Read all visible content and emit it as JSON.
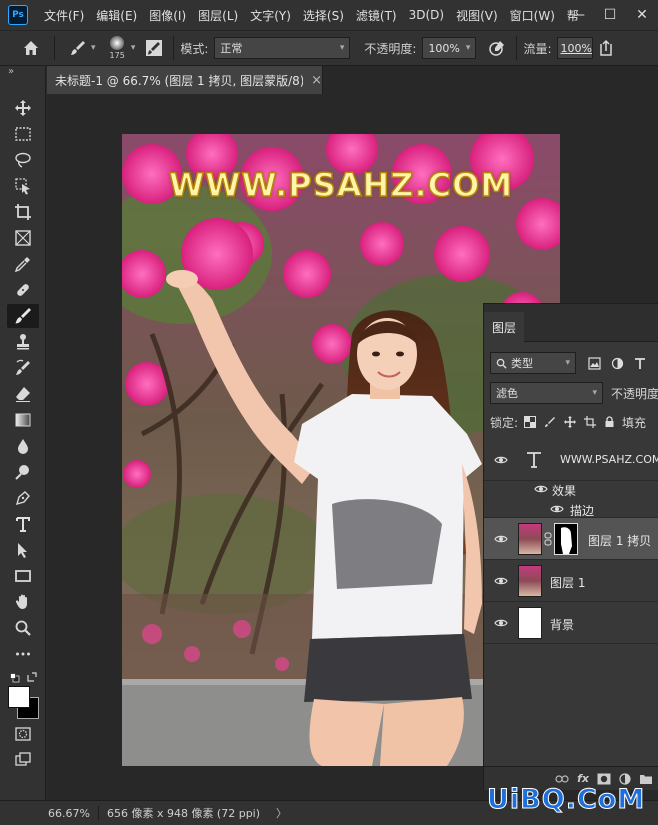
{
  "app": {
    "logo_text": "Ps"
  },
  "menu": [
    "文件(F)",
    "编辑(E)",
    "图像(I)",
    "图层(L)",
    "文字(Y)",
    "选择(S)",
    "滤镜(T)",
    "3D(D)",
    "视图(V)",
    "窗口(W)",
    "帮"
  ],
  "window_controls": {
    "minimize": "—",
    "maximize": "☐",
    "close": "✕"
  },
  "options": {
    "brush_size": "175",
    "mode_label": "模式:",
    "mode_value": "正常",
    "opacity_label": "不透明度:",
    "opacity_value": "100%",
    "flow_label": "流量:",
    "flow_value": "100%"
  },
  "document": {
    "tab_title": "未标题-1 @ 66.7% (图层 1 拷贝, 图层蒙版/8) *",
    "close_label": "×",
    "watermark": "WWW.PSAHZ.COM"
  },
  "status": {
    "zoom": "66.67%",
    "info": "656 像素 x 948 像素 (72 ppi)",
    "arrow": "〉"
  },
  "layers_panel": {
    "tab": "图层",
    "filter_label": "类型",
    "blend_mode": "滤色",
    "opacity_label": "不透明度",
    "lock_label": "锁定:",
    "fill_label": "填充",
    "layers": [
      {
        "name": "WWW.PSAHZ.COM",
        "kind": "text"
      },
      {
        "name": "效果",
        "kind": "effects"
      },
      {
        "name": "描边",
        "kind": "effect-item"
      },
      {
        "name": "图层 1 拷贝",
        "kind": "image-mask",
        "selected": true
      },
      {
        "name": "图层 1",
        "kind": "image"
      },
      {
        "name": "背景",
        "kind": "background"
      }
    ],
    "footer_fx": "fx"
  },
  "site_watermark": "UiBQ.CoM",
  "colors": {
    "accent": "#31a8ff",
    "panel": "#383838",
    "selected": "#545454"
  }
}
